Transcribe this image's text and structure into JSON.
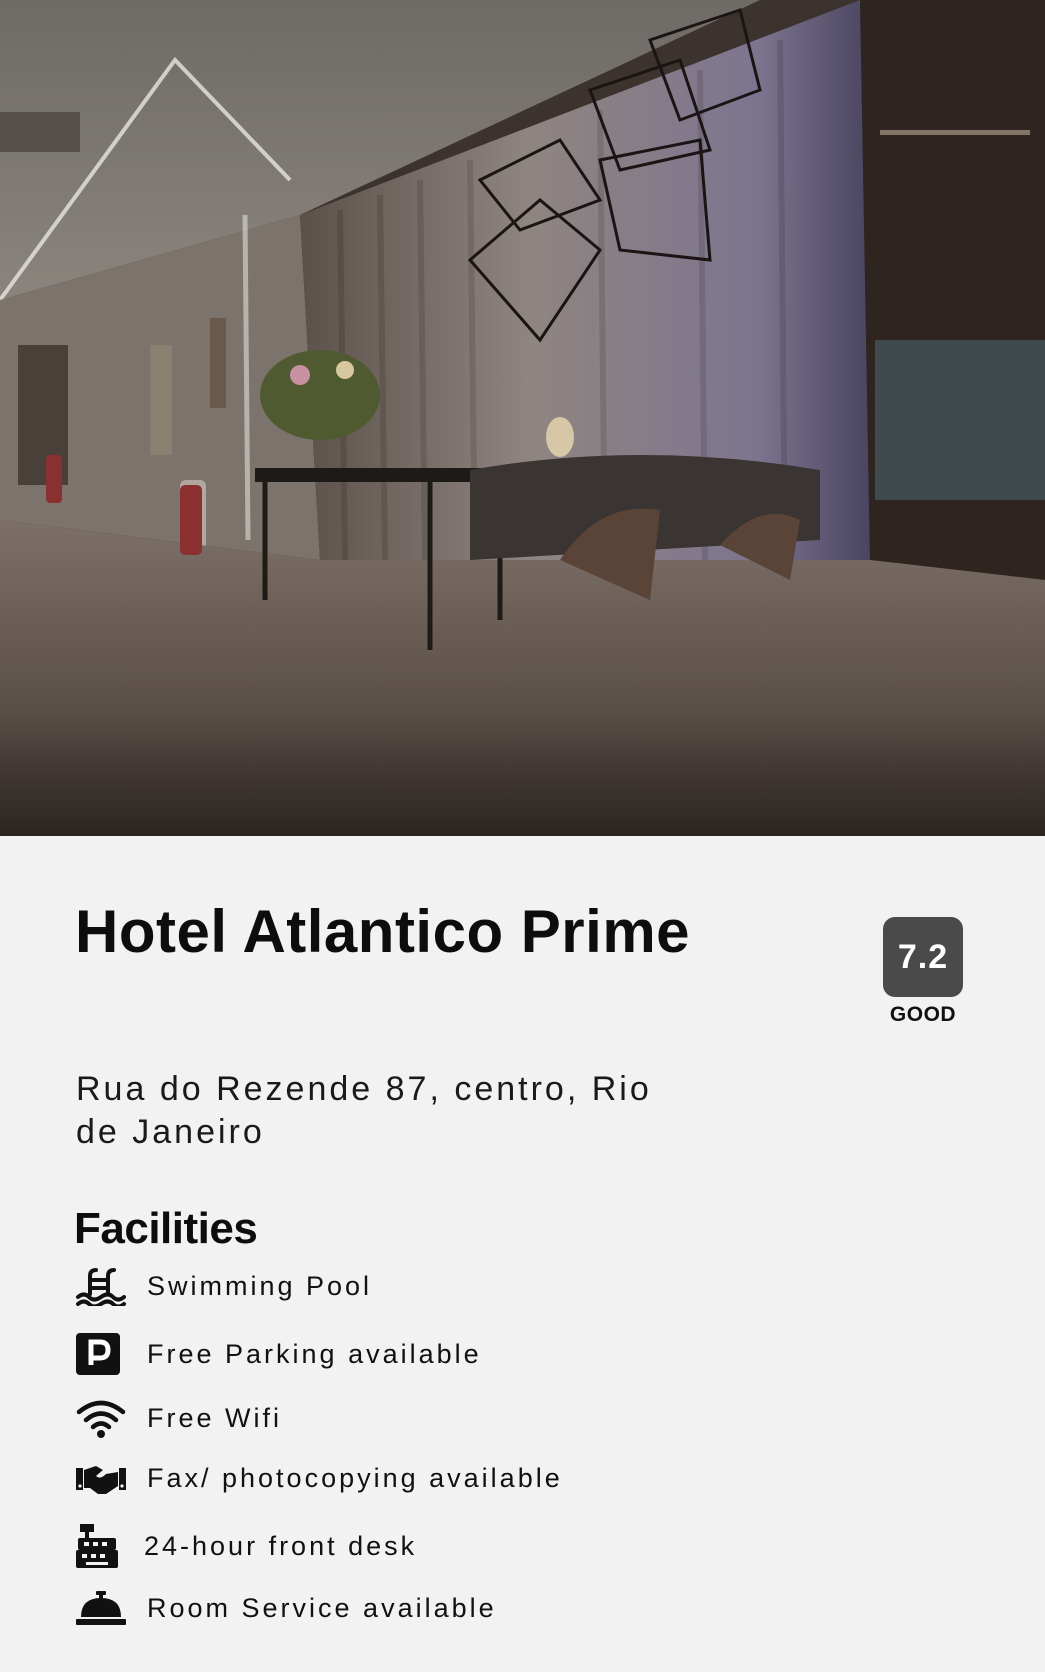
{
  "hotel": {
    "name": "Hotel Atlantico Prime",
    "address": "Rua do Rezende 87, centro, Rio de Janeiro",
    "rating": {
      "score": "7.2",
      "label": "GOOD",
      "badge_color": "#4a4a4a"
    }
  },
  "facilities": {
    "heading": "Facilities",
    "items": [
      {
        "icon": "swimming-pool-icon",
        "label": "Swimming Pool"
      },
      {
        "icon": "parking-icon",
        "label": "Free Parking available"
      },
      {
        "icon": "wifi-icon",
        "label": "Free Wifi"
      },
      {
        "icon": "handshake-icon",
        "label": "Fax/ photocopying available"
      },
      {
        "icon": "cash-register-icon",
        "label": "24-hour front desk"
      },
      {
        "icon": "concierge-bell-icon",
        "label": "Room Service available"
      }
    ]
  },
  "colors": {
    "background": "#f2f2f2",
    "text": "#111111"
  }
}
